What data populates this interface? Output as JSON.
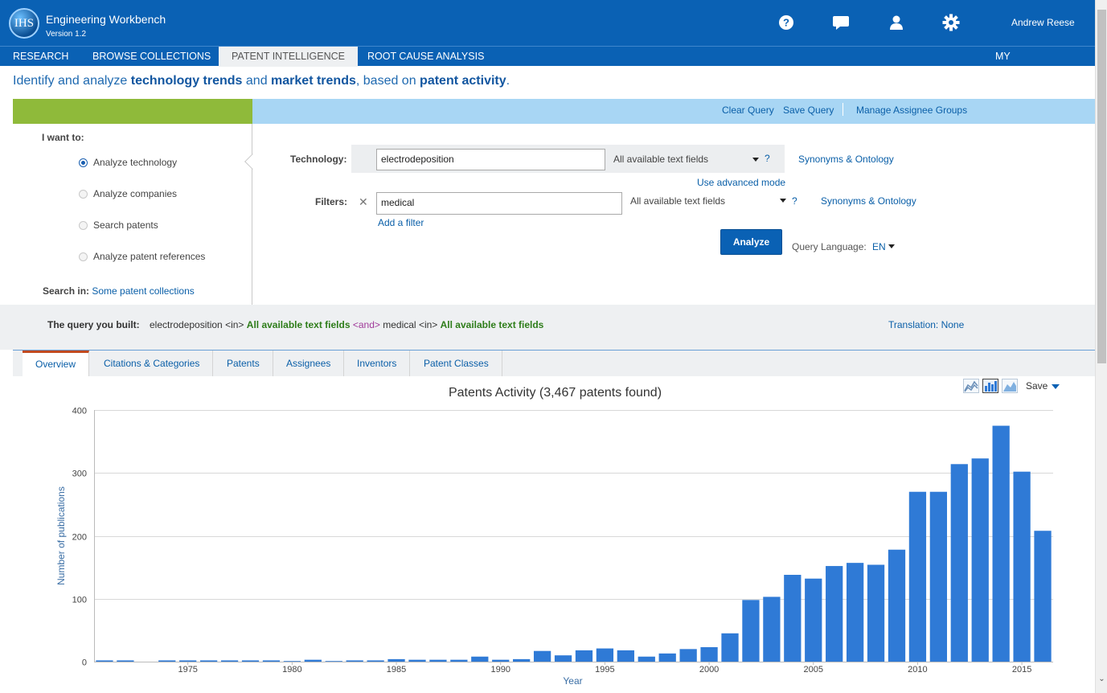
{
  "app": {
    "logo_text": "IHS",
    "title": "Engineering Workbench",
    "version": "Version 1.2",
    "user": "Andrew Reese",
    "header_icons": [
      "help-icon",
      "chat-icon",
      "user-icon",
      "settings-icon"
    ]
  },
  "nav": {
    "items": [
      "RESEARCH",
      "BROWSE COLLECTIONS",
      "PATENT INTELLIGENCE",
      "ROOT CAUSE ANALYSIS"
    ],
    "active": "PATENT INTELLIGENCE",
    "workspaces": "MY WORKSPACES"
  },
  "tagline": {
    "p1": "Identify and analyze ",
    "b1": "technology trends",
    "p2": " and ",
    "b2": "market trends",
    "p3": ", based on ",
    "b3": "patent activity",
    "p4": "."
  },
  "query_actions": {
    "clear": "Clear Query",
    "save": "Save Query",
    "manage": "Manage Assignee Groups"
  },
  "left": {
    "title": "I want to:",
    "options": [
      "Analyze technology",
      "Analyze companies",
      "Search patents",
      "Analyze patent references"
    ],
    "selected": "Analyze technology",
    "search_in_label": "Search in:",
    "search_in_value": "Some patent collections"
  },
  "form": {
    "technology_label": "Technology:",
    "technology_value": "electrodeposition",
    "technology_field": "All available text fields",
    "help": "?",
    "synonyms": "Synonyms & Ontology",
    "advanced": "Use advanced mode",
    "filters_label": "Filters:",
    "filter_value": "medical",
    "filter_field": "All available text fields",
    "add_filter": "Add a filter",
    "analyze": "Analyze",
    "query_language_label": "Query Language:",
    "query_language_value": "EN"
  },
  "query_built": {
    "label": "The query you built:",
    "term1": "electrodeposition",
    "in1": "<in>",
    "field1": "All available text fields",
    "op": "<and>",
    "term2": "medical",
    "in2": "<in>",
    "field2": "All available text fields",
    "translation": "Translation: None"
  },
  "tabs": {
    "items": [
      "Overview",
      "Citations & Categories",
      "Patents",
      "Assignees",
      "Inventors",
      "Patent Classes"
    ],
    "active": "Overview"
  },
  "chart_tools": {
    "icons": [
      "area-chart-icon",
      "bar-chart-icon",
      "mountain-chart-icon"
    ],
    "active": "bar-chart-icon",
    "save": "Save"
  },
  "chart_data": {
    "type": "bar",
    "title": "Patents Activity (3,467 patents found)",
    "xlabel": "Year",
    "ylabel": "Number of publications",
    "ylim": [
      0,
      400
    ],
    "yticks": [
      0,
      100,
      200,
      300,
      400
    ],
    "xtick_labels": [
      "1975",
      "1980",
      "1985",
      "1990",
      "1995",
      "2000",
      "2005",
      "2010",
      "2015"
    ],
    "grid": true,
    "color": "#2f7ad6",
    "categories": [
      1971,
      1972,
      1973,
      1974,
      1975,
      1976,
      1977,
      1978,
      1979,
      1980,
      1981,
      1982,
      1983,
      1984,
      1985,
      1986,
      1987,
      1988,
      1989,
      1990,
      1991,
      1992,
      1993,
      1994,
      1995,
      1996,
      1997,
      1998,
      1999,
      2000,
      2001,
      2002,
      2003,
      2004,
      2005,
      2006,
      2007,
      2008,
      2009,
      2010,
      2011,
      2012,
      2013,
      2014,
      2015,
      2016
    ],
    "values": [
      2,
      2,
      0,
      2,
      2,
      2,
      2,
      2,
      2,
      1,
      3,
      1,
      2,
      2,
      4,
      3,
      3,
      3,
      8,
      3,
      4,
      17,
      10,
      18,
      21,
      18,
      8,
      13,
      20,
      23,
      45,
      98,
      103,
      138,
      132,
      152,
      157,
      154,
      178,
      270,
      270,
      314,
      323,
      375,
      302,
      208
    ]
  },
  "colors": {
    "brand_blue": "#0a61b4",
    "green_band": "#8fba3a",
    "light_blue_band": "#a8d6f4",
    "active_tab_accent": "#c14a1f"
  }
}
